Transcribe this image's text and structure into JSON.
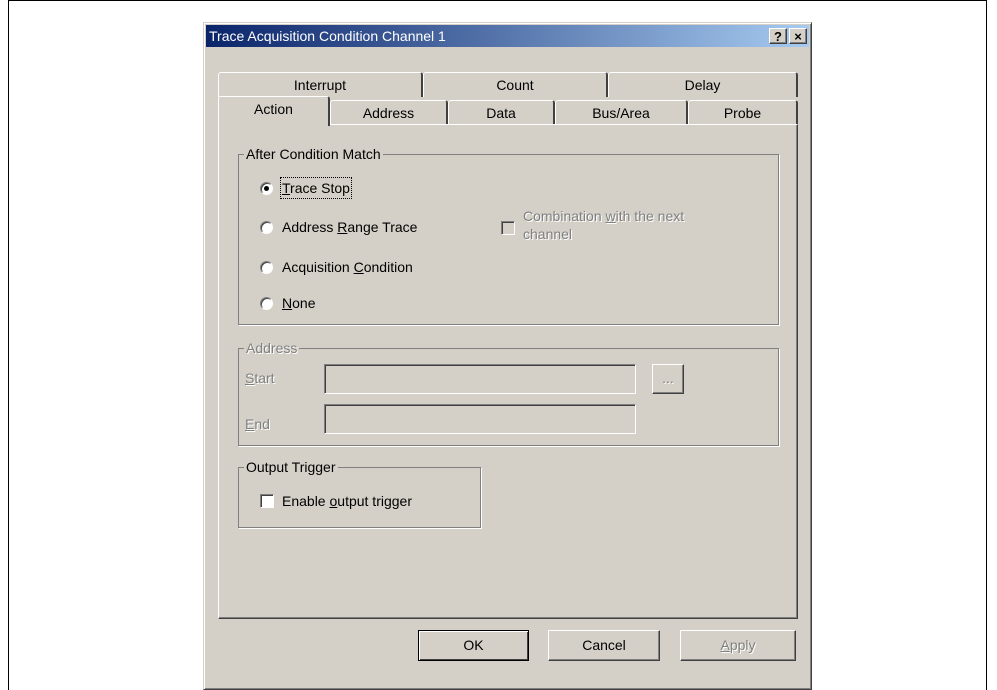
{
  "dialog": {
    "title": "Trace Acquisition Condition Channel 1",
    "help_button": "?",
    "close_button": "×"
  },
  "tabs": {
    "back_row": [
      "Interrupt",
      "Count",
      "Delay"
    ],
    "front_row": [
      "Action",
      "Address",
      "Data",
      "Bus/Area",
      "Probe"
    ],
    "active": "Action"
  },
  "after_condition": {
    "label": "After Condition Match",
    "options": {
      "trace_stop": {
        "pre": "",
        "key": "T",
        "post": "race Stop",
        "selected": true
      },
      "address_range": {
        "pre": "Address ",
        "key": "R",
        "post": "ange Trace",
        "selected": false
      },
      "acq_condition": {
        "pre": "Acquisition ",
        "key": "C",
        "post": "ondition",
        "selected": false
      },
      "none": {
        "pre": "",
        "key": "N",
        "post": "one",
        "selected": false
      }
    },
    "combination": {
      "line1_pre": "Combination ",
      "line1_key": "w",
      "line1_post": "ith the next",
      "line2": "channel",
      "checked": false,
      "enabled": false
    }
  },
  "address": {
    "label": "Address",
    "start_key": "S",
    "start_rest": "tart",
    "end_key": "E",
    "end_rest": "nd",
    "start_value": "",
    "end_value": "",
    "browse_label": "..."
  },
  "output_trigger": {
    "label": "Output Trigger",
    "checkbox_pre": "Enable ",
    "checkbox_key": "o",
    "checkbox_post": "utput trigger",
    "checked": false
  },
  "buttons": {
    "ok": "OK",
    "cancel": "Cancel",
    "apply_key": "A",
    "apply_rest": "pply"
  }
}
